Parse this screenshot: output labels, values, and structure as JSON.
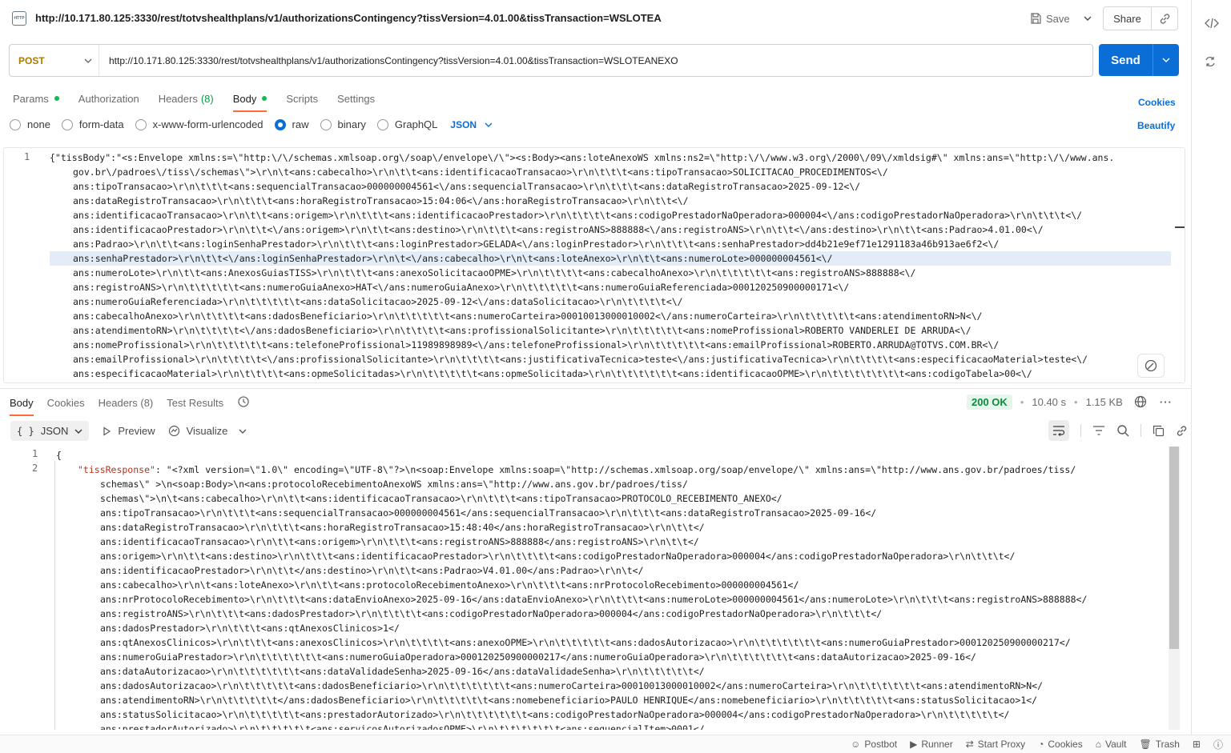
{
  "title_bar": {
    "title": "http://10.171.80.125:3330/rest/totvshealthplans/v1/authorizationsContingency?tissVersion=4.01.00&tissTransaction=WSLOTEA",
    "http_badge": "HTTP",
    "save_label": "Save",
    "share_label": "Share"
  },
  "request": {
    "method": "POST",
    "url": "http://10.171.80.125:3330/rest/totvshealthplans/v1/authorizationsContingency?tissVersion=4.01.00&tissTransaction=WSLOTEANEXO",
    "send_label": "Send",
    "tabs": [
      {
        "label": "Params",
        "dot": true
      },
      {
        "label": "Authorization"
      },
      {
        "label": "Headers",
        "count": "(8)"
      },
      {
        "label": "Body",
        "dot": true,
        "active": true
      },
      {
        "label": "Scripts"
      },
      {
        "label": "Settings"
      }
    ],
    "cookies_link": "Cookies",
    "beautify_link": "Beautify",
    "body_types": [
      "none",
      "form-data",
      "x-www-form-urlencoded",
      "raw",
      "binary",
      "GraphQL"
    ],
    "body_type_selected": "raw",
    "format": "JSON",
    "editor_line": "1",
    "body_lines": [
      "{\"tissBody\":\"<s:Envelope xmlns:s=\\\"http:\\/\\/schemas.xmlsoap.org\\/soap\\/envelope\\/\\\"><s:Body><ans:loteAnexoWS xmlns:ns2=\\\"http:\\/\\/www.w3.org\\/2000\\/09\\/xmldsig#\\\" xmlns:ans=\\\"http:\\/\\/www.ans.",
      "gov.br\\/padroes\\/tiss\\/schemas\\\">\\r\\n\\t<ans:cabecalho>\\r\\n\\t\\t<ans:identificacaoTransacao>\\r\\n\\t\\t\\t<ans:tipoTransacao>SOLICITACAO_PROCEDIMENTOS<\\/",
      "ans:tipoTransacao>\\r\\n\\t\\t\\t<ans:sequencialTransacao>000000004561<\\/ans:sequencialTransacao>\\r\\n\\t\\t\\t<ans:dataRegistroTransacao>2025-09-12<\\/",
      "ans:dataRegistroTransacao>\\r\\n\\t\\t\\t<ans:horaRegistroTransacao>15:04:06<\\/ans:horaRegistroTransacao>\\r\\n\\t\\t<\\/",
      "ans:identificacaoTransacao>\\r\\n\\t\\t<ans:origem>\\r\\n\\t\\t\\t<ans:identificacaoPrestador>\\r\\n\\t\\t\\t\\t<ans:codigoPrestadorNaOperadora>000004<\\/ans:codigoPrestadorNaOperadora>\\r\\n\\t\\t\\t<\\/",
      "ans:identificacaoPrestador>\\r\\n\\t\\t<\\/ans:origem>\\r\\n\\t\\t<ans:destino>\\r\\n\\t\\t\\t<ans:registroANS>888888<\\/ans:registroANS>\\r\\n\\t\\t<\\/ans:destino>\\r\\n\\t\\t<ans:Padrao>4.01.00<\\/",
      "ans:Padrao>\\r\\n\\t\\t<ans:loginSenhaPrestador>\\r\\n\\t\\t\\t<ans:loginPrestador>GELADA<\\/ans:loginPrestador>\\r\\n\\t\\t\\t<ans:senhaPrestador>dd4b21e9ef71e1291183a46b913ae6f2<\\/",
      "ans:senhaPrestador>\\r\\n\\t\\t<\\/ans:loginSenhaPrestador>\\r\\n\\t<\\/ans:cabecalho>\\r\\n\\t<ans:loteAnexo>\\r\\n\\t\\t<ans:numeroLote>000000004561<\\/",
      "ans:numeroLote>\\r\\n\\t\\t<ans:AnexosGuiasTISS>\\r\\n\\t\\t\\t<ans:anexoSolicitacaoOPME>\\r\\n\\t\\t\\t\\t<ans:cabecalhoAnexo>\\r\\n\\t\\t\\t\\t\\t<ans:registroANS>888888<\\/",
      "ans:registroANS>\\r\\n\\t\\t\\t\\t\\t<ans:numeroGuiaAnexo>HAT<\\/ans:numeroGuiaAnexo>\\r\\n\\t\\t\\t\\t\\t<ans:numeroGuiaReferenciada>000120250900000171<\\/",
      "ans:numeroGuiaReferenciada>\\r\\n\\t\\t\\t\\t\\t<ans:dataSolicitacao>2025-09-12<\\/ans:dataSolicitacao>\\r\\n\\t\\t\\t\\t<\\/",
      "ans:cabecalhoAnexo>\\r\\n\\t\\t\\t\\t<ans:dadosBeneficiario>\\r\\n\\t\\t\\t\\t\\t<ans:numeroCarteira>00010013000010002<\\/ans:numeroCarteira>\\r\\n\\t\\t\\t\\t\\t<ans:atendimentoRN>N<\\/",
      "ans:atendimentoRN>\\r\\n\\t\\t\\t\\t<\\/ans:dadosBeneficiario>\\r\\n\\t\\t\\t\\t<ans:profissionalSolicitante>\\r\\n\\t\\t\\t\\t\\t<ans:nomeProfissional>ROBERTO VANDERLEI DE ARRUDA<\\/",
      "ans:nomeProfissional>\\r\\n\\t\\t\\t\\t\\t<ans:telefoneProfissional>11989898989<\\/ans:telefoneProfissional>\\r\\n\\t\\t\\t\\t\\t<ans:emailProfissional>ROBERTO.ARRUDA@TOTVS.COM.BR<\\/",
      "ans:emailProfissional>\\r\\n\\t\\t\\t\\t<\\/ans:profissionalSolicitante>\\r\\n\\t\\t\\t\\t<ans:justificativaTecnica>teste<\\/ans:justificativaTecnica>\\r\\n\\t\\t\\t\\t<ans:especificacaoMaterial>teste<\\/",
      "ans:especificacaoMaterial>\\r\\n\\t\\t\\t\\t<ans:opmeSolicitadas>\\r\\n\\t\\t\\t\\t\\t<ans:opmeSolicitada>\\r\\n\\t\\t\\t\\t\\t\\t<ans:identificacaoOPME>\\r\\n\\t\\t\\t\\t\\t\\t\\t<ans:codigoTabela>00<\\/"
    ]
  },
  "response": {
    "tabs": [
      {
        "label": "Body",
        "active": true
      },
      {
        "label": "Cookies"
      },
      {
        "label": "Headers",
        "count": "(8)"
      },
      {
        "label": "Test Results"
      }
    ],
    "status": "200 OK",
    "time": "10.40 s",
    "size": "1.15 KB",
    "format": "JSON",
    "preview_label": "Preview",
    "visualize_label": "Visualize",
    "line_numbers": [
      "1",
      "2"
    ],
    "open_brace": "{",
    "key": "\"tissResponse\"",
    "lines": [
      ": \"<?xml version=\\\"1.0\\\" encoding=\\\"UTF-8\\\"?>\\n<soap:Envelope xmlns:soap=\\\"http://schemas.xmlsoap.org/soap/envelope/\\\" xmlns:ans=\\\"http://www.ans.gov.br/padroes/tiss/",
      "schemas\\\" >\\n<soap:Body>\\n<ans:protocoloRecebimentoAnexoWS xmlns:ans=\\\"http://www.ans.gov.br/padroes/tiss/",
      "schemas\\\">\\n\\t<ans:cabecalho>\\r\\n\\t\\t<ans:identificacaoTransacao>\\r\\n\\t\\t\\t<ans:tipoTransacao>PROTOCOLO_RECEBIMENTO_ANEXO</",
      "ans:tipoTransacao>\\r\\n\\t\\t\\t<ans:sequencialTransacao>000000004561</ans:sequencialTransacao>\\r\\n\\t\\t\\t<ans:dataRegistroTransacao>2025-09-16</",
      "ans:dataRegistroTransacao>\\r\\n\\t\\t\\t<ans:horaRegistroTransacao>15:48:40</ans:horaRegistroTransacao>\\r\\n\\t\\t</",
      "ans:identificacaoTransacao>\\r\\n\\t\\t<ans:origem>\\r\\n\\t\\t\\t<ans:registroANS>888888</ans:registroANS>\\r\\n\\t\\t</",
      "ans:origem>\\r\\n\\t\\t<ans:destino>\\r\\n\\t\\t\\t<ans:identificacaoPrestador>\\r\\n\\t\\t\\t\\t<ans:codigoPrestadorNaOperadora>000004</ans:codigoPrestadorNaOperadora>\\r\\n\\t\\t\\t</",
      "ans:identificacaoPrestador>\\r\\n\\t\\t</ans:destino>\\r\\n\\t\\t<ans:Padrao>V4.01.00</ans:Padrao>\\r\\n\\t</",
      "ans:cabecalho>\\r\\n\\t<ans:loteAnexo>\\r\\n\\t\\t<ans:protocoloRecebimentoAnexo>\\r\\n\\t\\t\\t<ans:nrProtocoloRecebimento>000000004561</",
      "ans:nrProtocoloRecebimento>\\r\\n\\t\\t\\t<ans:dataEnvioAnexo>2025-09-16</ans:dataEnvioAnexo>\\r\\n\\t\\t\\t<ans:numeroLote>000000004561</ans:numeroLote>\\r\\n\\t\\t\\t<ans:registroANS>888888</",
      "ans:registroANS>\\r\\n\\t\\t\\t<ans:dadosPrestador>\\r\\n\\t\\t\\t\\t<ans:codigoPrestadorNaOperadora>000004</ans:codigoPrestadorNaOperadora>\\r\\n\\t\\t\\t</",
      "ans:dadosPrestador>\\r\\n\\t\\t\\t<ans:qtAnexosClinicos>1</",
      "ans:qtAnexosClinicos>\\r\\n\\t\\t\\t<ans:anexosClinicos>\\r\\n\\t\\t\\t\\t<ans:anexoOPME>\\r\\n\\t\\t\\t\\t\\t<ans:dadosAutorizacao>\\r\\n\\t\\t\\t\\t\\t\\t<ans:numeroGuiaPrestador>000120250900000217</",
      "ans:numeroGuiaPrestador>\\r\\n\\t\\t\\t\\t\\t\\t<ans:numeroGuiaOperadora>000120250900000217</ans:numeroGuiaOperadora>\\r\\n\\t\\t\\t\\t\\t\\t<ans:dataAutorizacao>2025-09-16</",
      "ans:dataAutorizacao>\\r\\n\\t\\t\\t\\t\\t\\t<ans:dataValidadeSenha>2025-09-16</ans:dataValidadeSenha>\\r\\n\\t\\t\\t\\t\\t</",
      "ans:dadosAutorizacao>\\r\\n\\t\\t\\t\\t\\t<ans:dadosBeneficiario>\\r\\n\\t\\t\\t\\t\\t\\t<ans:numeroCarteira>00010013000010002</ans:numeroCarteira>\\r\\n\\t\\t\\t\\t\\t\\t<ans:atendimentoRN>N</",
      "ans:atendimentoRN>\\r\\n\\t\\t\\t\\t\\t</ans:dadosBeneficiario>\\r\\n\\t\\t\\t\\t\\t<ans:nomebeneficiario>PAULO HENRIQUE</ans:nomebeneficiario>\\r\\n\\t\\t\\t\\t\\t<ans:statusSolicitacao>1</",
      "ans:statusSolicitacao>\\r\\n\\t\\t\\t\\t\\t<ans:prestadorAutorizado>\\r\\n\\t\\t\\t\\t\\t\\t<ans:codigoPrestadorNaOperadora>000004</ans:codigoPrestadorNaOperadora>\\r\\n\\t\\t\\t\\t\\t</",
      "ans:prestadorAutorizado>\\r\\n\\t\\t\\t\\t\\t<ans:servicosAutorizadosOPME>\\r\\n\\t\\t\\t\\t\\t\\t<ans:sequencialItem>0001</"
    ]
  },
  "footer": {
    "items": [
      "Postbot",
      "Runner",
      "Start Proxy",
      "Cookies",
      "Vault",
      "Trash"
    ]
  },
  "colors": {
    "accent": "#0b6ed7",
    "method": "#ad7a03",
    "tab_indicator": "#ff6c37",
    "status_ok": "#0b8a3c"
  }
}
